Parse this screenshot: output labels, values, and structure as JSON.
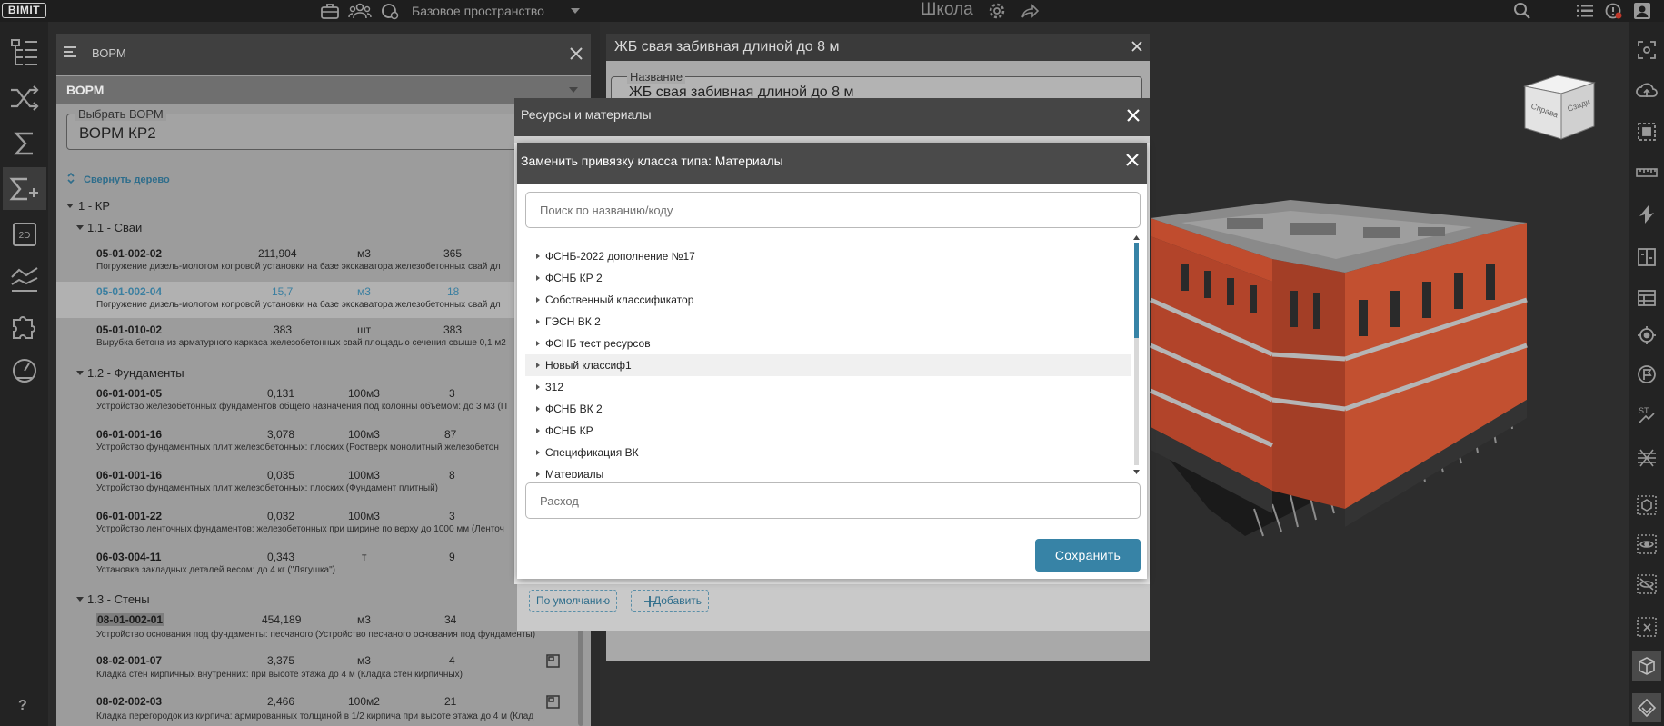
{
  "app": {
    "logo": "BIMIT"
  },
  "topbar": {
    "space_label": "Базовое пространство",
    "project_title": "Школа"
  },
  "left_rail": {
    "items": [
      {
        "icon": "tree-icon"
      },
      {
        "icon": "shuffle-icon"
      },
      {
        "icon": "sum-icon"
      },
      {
        "icon": "sum-plus-icon",
        "active": true
      },
      {
        "icon": "2d-icon",
        "label": "2D"
      },
      {
        "icon": "chart-lines-icon"
      },
      {
        "icon": "puzzle-icon"
      },
      {
        "icon": "gauge-icon"
      }
    ],
    "help": "?"
  },
  "vorm": {
    "title": "ВОРМ",
    "subtitle": "ВОРМ",
    "select_label": "Выбрать ВОРМ",
    "select_value": "ВОРМ КР2",
    "collapse_label": "Свернуть дерево",
    "group": "1 - КР",
    "sections": [
      {
        "title": "1.1 - Сваи",
        "rows": [
          {
            "code": "05-01-002-02",
            "qty": "211,904",
            "unit": "м3",
            "count": "365",
            "desc": "Погружение дизель-молотом копровой установки на базе экскаватора железобетонных свай дл"
          },
          {
            "code": "05-01-002-04",
            "qty": "15,7",
            "unit": "м3",
            "count": "18",
            "desc": "Погружение дизель-молотом копровой установки на базе экскаватора железобетонных свай дл",
            "selected": true
          },
          {
            "code": "05-01-010-02",
            "qty": "383",
            "unit": "шт",
            "count": "383",
            "desc": "Вырубка бетона из арматурного каркаса железобетонных свай площадью сечения свыше 0,1 м2"
          }
        ]
      },
      {
        "title": "1.2 - Фундаменты",
        "rows": [
          {
            "code": "06-01-001-05",
            "qty": "0,131",
            "unit": "100м3",
            "count": "3",
            "desc": "Устройство железобетонных фундаментов общего назначения под колонны объемом: до 3 м3 (П"
          },
          {
            "code": "06-01-001-16",
            "qty": "3,078",
            "unit": "100м3",
            "count": "87",
            "desc": "Устройство фундаментных плит железобетонных: плоских (Ростверк монолитный железобетон"
          },
          {
            "code": "06-01-001-16",
            "qty": "0,035",
            "unit": "100м3",
            "count": "8",
            "desc": "Устройство фундаментных плит железобетонных: плоских (Фундамент плитный)"
          },
          {
            "code": "06-01-001-22",
            "qty": "0,032",
            "unit": "100м3",
            "count": "3",
            "desc": "Устройство ленточных фундаментов: железобетонных при ширине по верху до 1000 мм (Ленточ"
          },
          {
            "code": "06-03-004-11",
            "qty": "0,343",
            "unit": "т",
            "count": "9",
            "desc": "Установка закладных деталей весом: до 4 кг (\"Лягушка\")"
          }
        ]
      },
      {
        "title": "1.3 - Стены",
        "rows": [
          {
            "code": "08-01-002-01",
            "qty": "454,189",
            "unit": "м3",
            "count": "34",
            "desc": "Устройство основания под фундаменты: песчаного (Устройство песчаного основания под фундаменты)"
          },
          {
            "code": "08-02-001-07",
            "qty": "3,375",
            "unit": "м3",
            "count": "4",
            "desc": "Кладка стен кирпичных внутренних: при высоте этажа до 4 м (Кладка стен кирпичных)"
          },
          {
            "code": "08-02-002-03",
            "qty": "2,466",
            "unit": "100м2",
            "count": "21",
            "desc": "Кладка перегородок из кирпича: армированных толщиной в 1/2 кирпича при высоте этажа до 4 м (Клад"
          }
        ]
      }
    ]
  },
  "element_card": {
    "title": "ЖБ свая забивная длиной до 8 м",
    "name_label": "Название",
    "name_value": "ЖБ свая забивная длиной до 8 м",
    "default_button": "По умолчанию",
    "add_button": "Добавить"
  },
  "resources_dialog": {
    "title": "Ресурсы и материалы"
  },
  "replace_dialog": {
    "title_prefix": "Заменить привязку класса типа:",
    "title_value": "Материалы",
    "search_placeholder": "Поиск по названию/коду",
    "classifiers": [
      "ФСНБ-2022 дополнение №17",
      "ФСНБ КР 2",
      "Собственный классификатор",
      "ГЭСН ВК 2",
      "ФСНБ тест ресурсов",
      "Новый классиф1",
      "312",
      "ФСНБ ВК 2",
      "ФСНБ КР",
      "Спецификация ВК",
      "Материалы"
    ],
    "consumption_placeholder": "Расход",
    "save_label": "Сохранить"
  },
  "right_rail": {
    "items": [
      "focus-icon",
      "cloud-upload-icon",
      "select-box-icon",
      "ruler-icon",
      "section-plane-icon",
      "split-view-icon",
      "grid-table-icon",
      "target-icon",
      "flag-icon",
      "elevation-icon",
      "rebar-icon",
      "cube-icon",
      "eye-icon",
      "eye-off-icon",
      "box-x-icon",
      "solid-cube-icon",
      "layers-icon"
    ]
  }
}
